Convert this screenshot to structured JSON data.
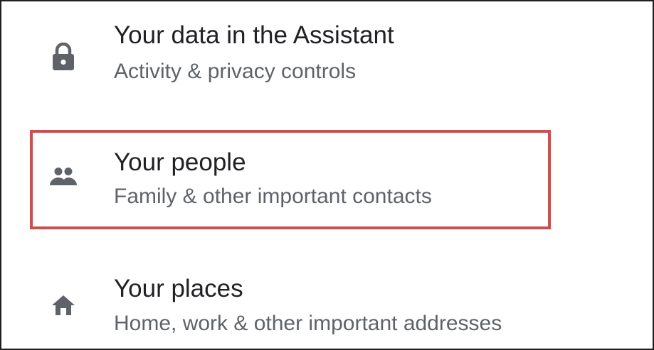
{
  "settings_list": {
    "items": [
      {
        "icon": "lock-icon",
        "title": "Your data in the Assistant",
        "subtitle": "Activity & privacy controls"
      },
      {
        "icon": "people-icon",
        "title": "Your people",
        "subtitle": "Family & other important contacts",
        "highlighted": true
      },
      {
        "icon": "home-icon",
        "title": "Your places",
        "subtitle": "Home, work & other important addresses"
      }
    ]
  },
  "colors": {
    "title_text": "#202124",
    "subtitle_text": "#5f6368",
    "icon": "#5f6368",
    "highlight_border": "#c8504f",
    "frame_border": "#1f1f1f"
  }
}
